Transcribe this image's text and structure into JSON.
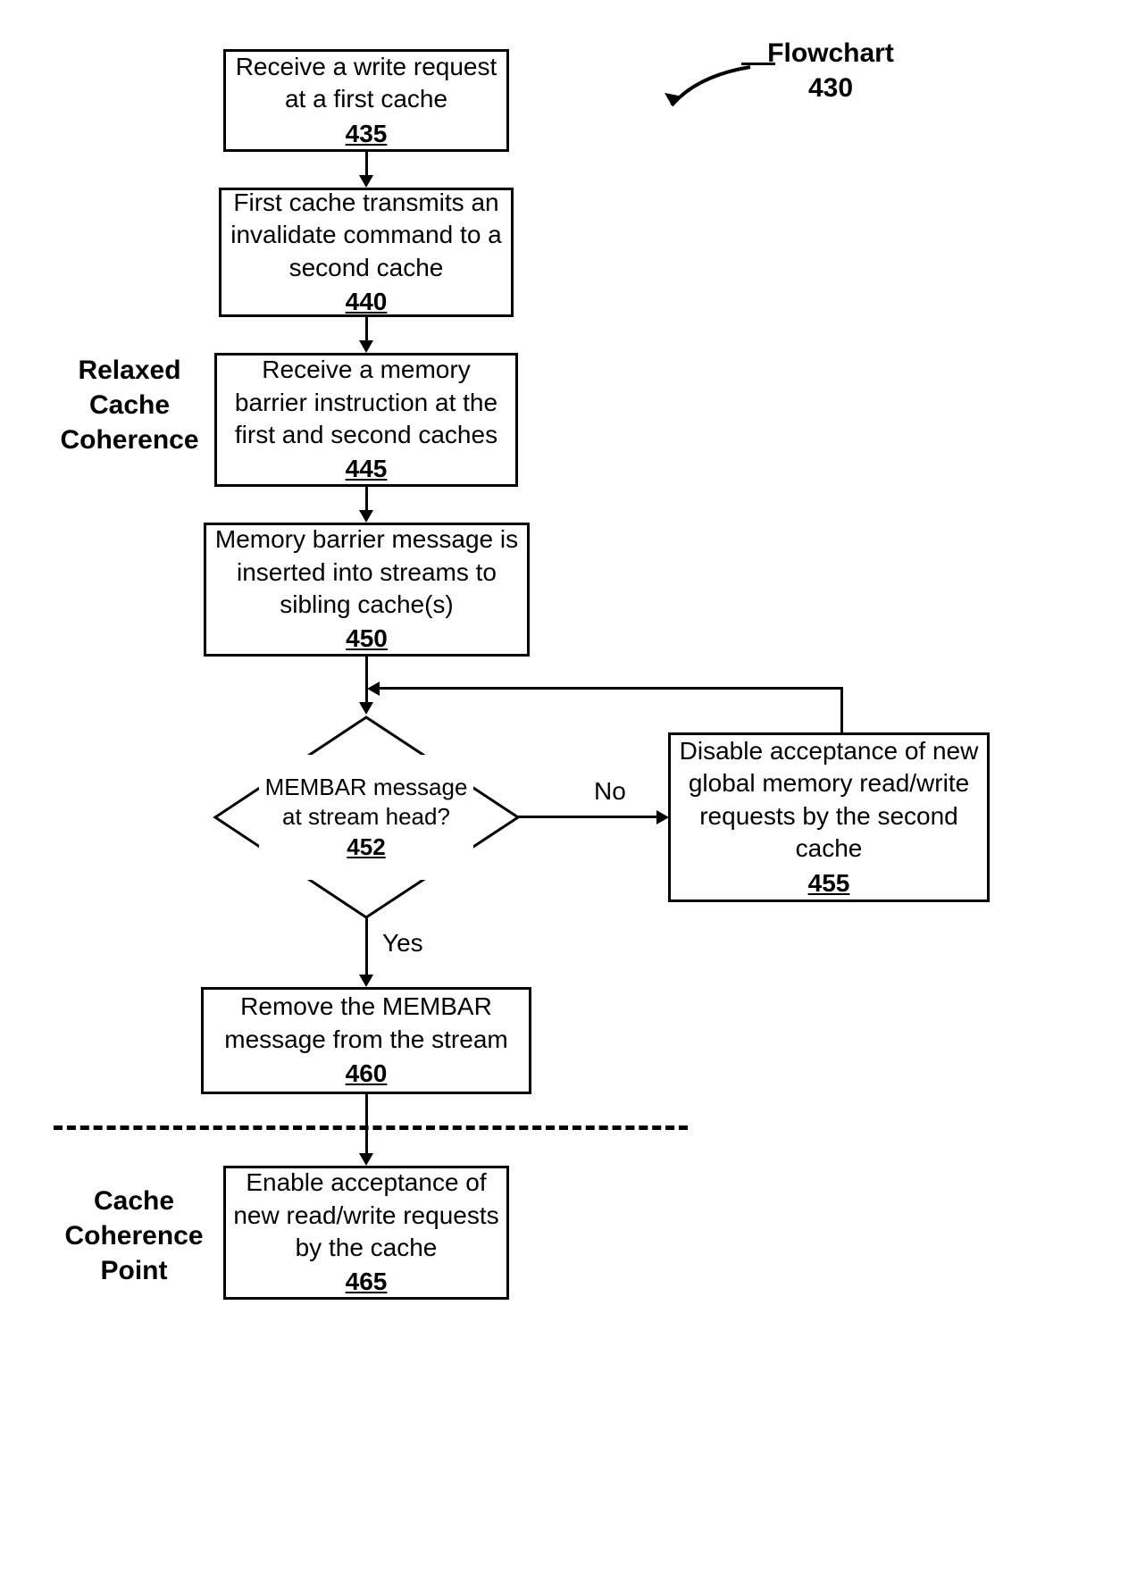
{
  "header": {
    "title": "Flowchart",
    "number": "430"
  },
  "labels": {
    "relaxed": "Relaxed\nCache\nCoherence",
    "point": "Cache\nCoherence\nPoint",
    "no": "No",
    "yes": "Yes"
  },
  "boxes": {
    "b435": {
      "text": "Receive a write request at a first cache",
      "num": "435"
    },
    "b440": {
      "text": "First cache transmits an invalidate command to a second cache",
      "num": "440"
    },
    "b445": {
      "text": "Receive a memory barrier instruction at the first and second caches",
      "num": "445"
    },
    "b450": {
      "text": "Memory barrier message is inserted into streams to sibling cache(s)",
      "num": "450"
    },
    "b452": {
      "text": "MEMBAR message at stream head?",
      "num": "452"
    },
    "b455": {
      "text": "Disable acceptance of new global memory read/write requests by the second cache",
      "num": "455"
    },
    "b460": {
      "text": "Remove the MEMBAR message from the stream",
      "num": "460"
    },
    "b465": {
      "text": "Enable acceptance of new read/write requests by the cache",
      "num": "465"
    }
  }
}
